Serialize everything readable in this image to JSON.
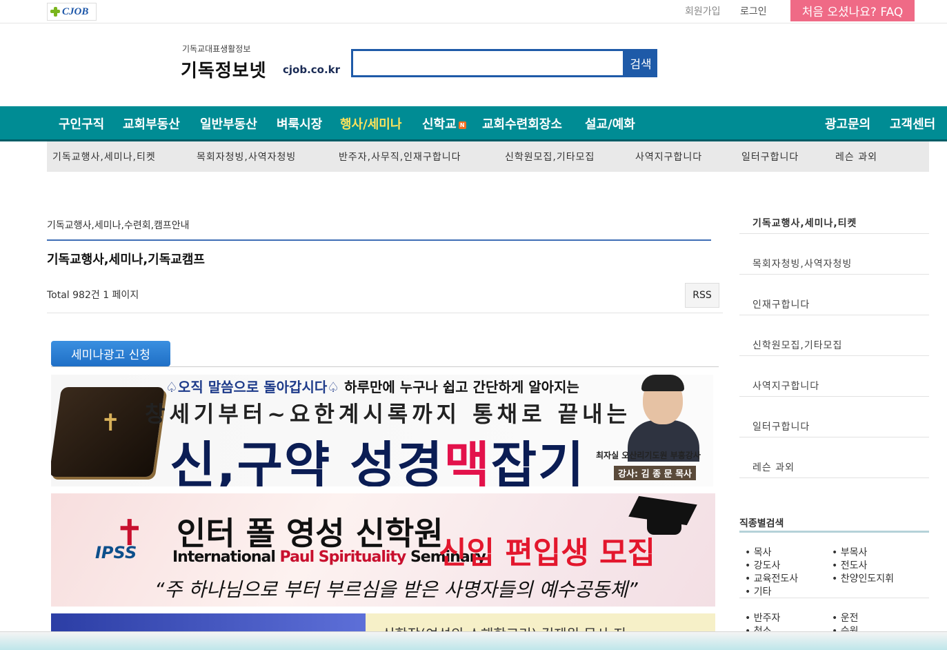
{
  "top": {
    "logo_text": "CJOB",
    "join": "회원가입",
    "login": "로그인",
    "faq": "처음 오셨나요? FAQ"
  },
  "header": {
    "brand_sub": "기독교대표생활정보",
    "brand_main": "기독정보넷",
    "brand_domain": "cjob.co.kr",
    "search_placeholder": "",
    "search_value": "",
    "search_button": "검색"
  },
  "main_nav": [
    "구인구직",
    "교회부동산",
    "일반부동산",
    "벼룩시장",
    "행사/세미나",
    "신학교",
    "교회수련회장소",
    "설교/예화"
  ],
  "main_nav_right": [
    "광고문의",
    "고객센터"
  ],
  "main_nav_badge": "N",
  "sub_nav": [
    "기독교행사,세미나,티켓",
    "목회자청빙,사역자청빙",
    "반주자,사무직,인재구합니다",
    "신학원모집,기타모집",
    "사역지구합니다",
    "일터구합니다",
    "레슨 과외"
  ],
  "board": {
    "breadcrumb": "기독교행사,세미나,수련회,캠프안내",
    "title": "기독교행사,세미나,기독교캠프",
    "total": "Total 982건 1 페이지",
    "rss": "RSS",
    "apply_button": "세미나광고 신청"
  },
  "banners": {
    "b1_line1_a": "♤오직 말씀으로 돌아갑시다♤",
    "b1_line1_b": " 하루만에 누구나 쉽고 간단하게 알아지는",
    "b1_line2": "창세기부터~요한계시록까지 통채로 끝내는",
    "b1_line3_a": "신,구약 성경",
    "b1_line3_b": "맥",
    "b1_line3_c": "잡기",
    "b1_caption1": "최자실 오산리기도원 부흥강사",
    "b1_caption2": "강사: 김 종 문 목사",
    "b2_logo": "IPSS",
    "b2_title": "인터 폴 영성 신학원",
    "b2_eng_1": "International ",
    "b2_eng_2": "Paul ",
    "b2_eng_3": "Spirituality ",
    "b2_eng_4": "Seminary",
    "b2_recruit": "신입 편입생 모집",
    "b2_quote": "“주 하나님으로 부터 부르심을 받은 사명자들의 예수공동체”",
    "b3_text": "신학장(여섯의 소해학교리) 김제원 목사 지"
  },
  "sidebar": [
    "기독교행사,세미나,티켓",
    "목회자청빙,사역자청빙",
    "인재구합니다",
    "신학원모집,기타모집",
    "사역지구합니다",
    "일터구합니다",
    "레슨 과외"
  ],
  "job_search": {
    "title": "직종별검색",
    "group1": [
      "목사",
      "부목사",
      "강도사",
      "전도사",
      "교육전도사",
      "찬양인도지휘",
      "기타"
    ],
    "group2": [
      "반주자",
      "운전",
      "청소",
      "승원"
    ]
  }
}
